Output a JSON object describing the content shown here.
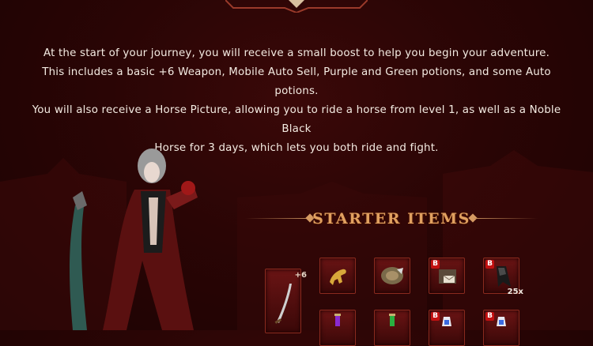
{
  "intro": {
    "line1": "At the start of your journey, you will receive a small boost to help you begin your adventure.",
    "line2": "This includes a basic +6 Weapon, Mobile Auto Sell, Purple and Green potions, and some Auto potions.",
    "line3": "You will also receive a Horse Picture, allowing you to ride a horse from level 1, as well as a Noble Black",
    "line4": "Horse for 3 days, which lets you both ride and fight."
  },
  "starter": {
    "title": "STARTER ITEMS",
    "weapon_plus": "+6",
    "items": [
      {
        "icon": "horse-picture-icon"
      },
      {
        "icon": "mobile-auto-sell-icon"
      },
      {
        "icon": "letter-box-icon",
        "badge": "B"
      },
      {
        "icon": "cloak-icon",
        "badge": "B",
        "qty": "25x"
      },
      {
        "icon": "purple-potion-icon"
      },
      {
        "icon": "green-potion-icon"
      },
      {
        "icon": "auto-potion-icon",
        "badge": "B"
      },
      {
        "icon": "auto-potion-icon",
        "badge": "B"
      }
    ]
  },
  "colors": {
    "background": "#2a0505",
    "title": "#e0a060",
    "slot_border": "#8a2a1e",
    "badge": "#c21010"
  }
}
